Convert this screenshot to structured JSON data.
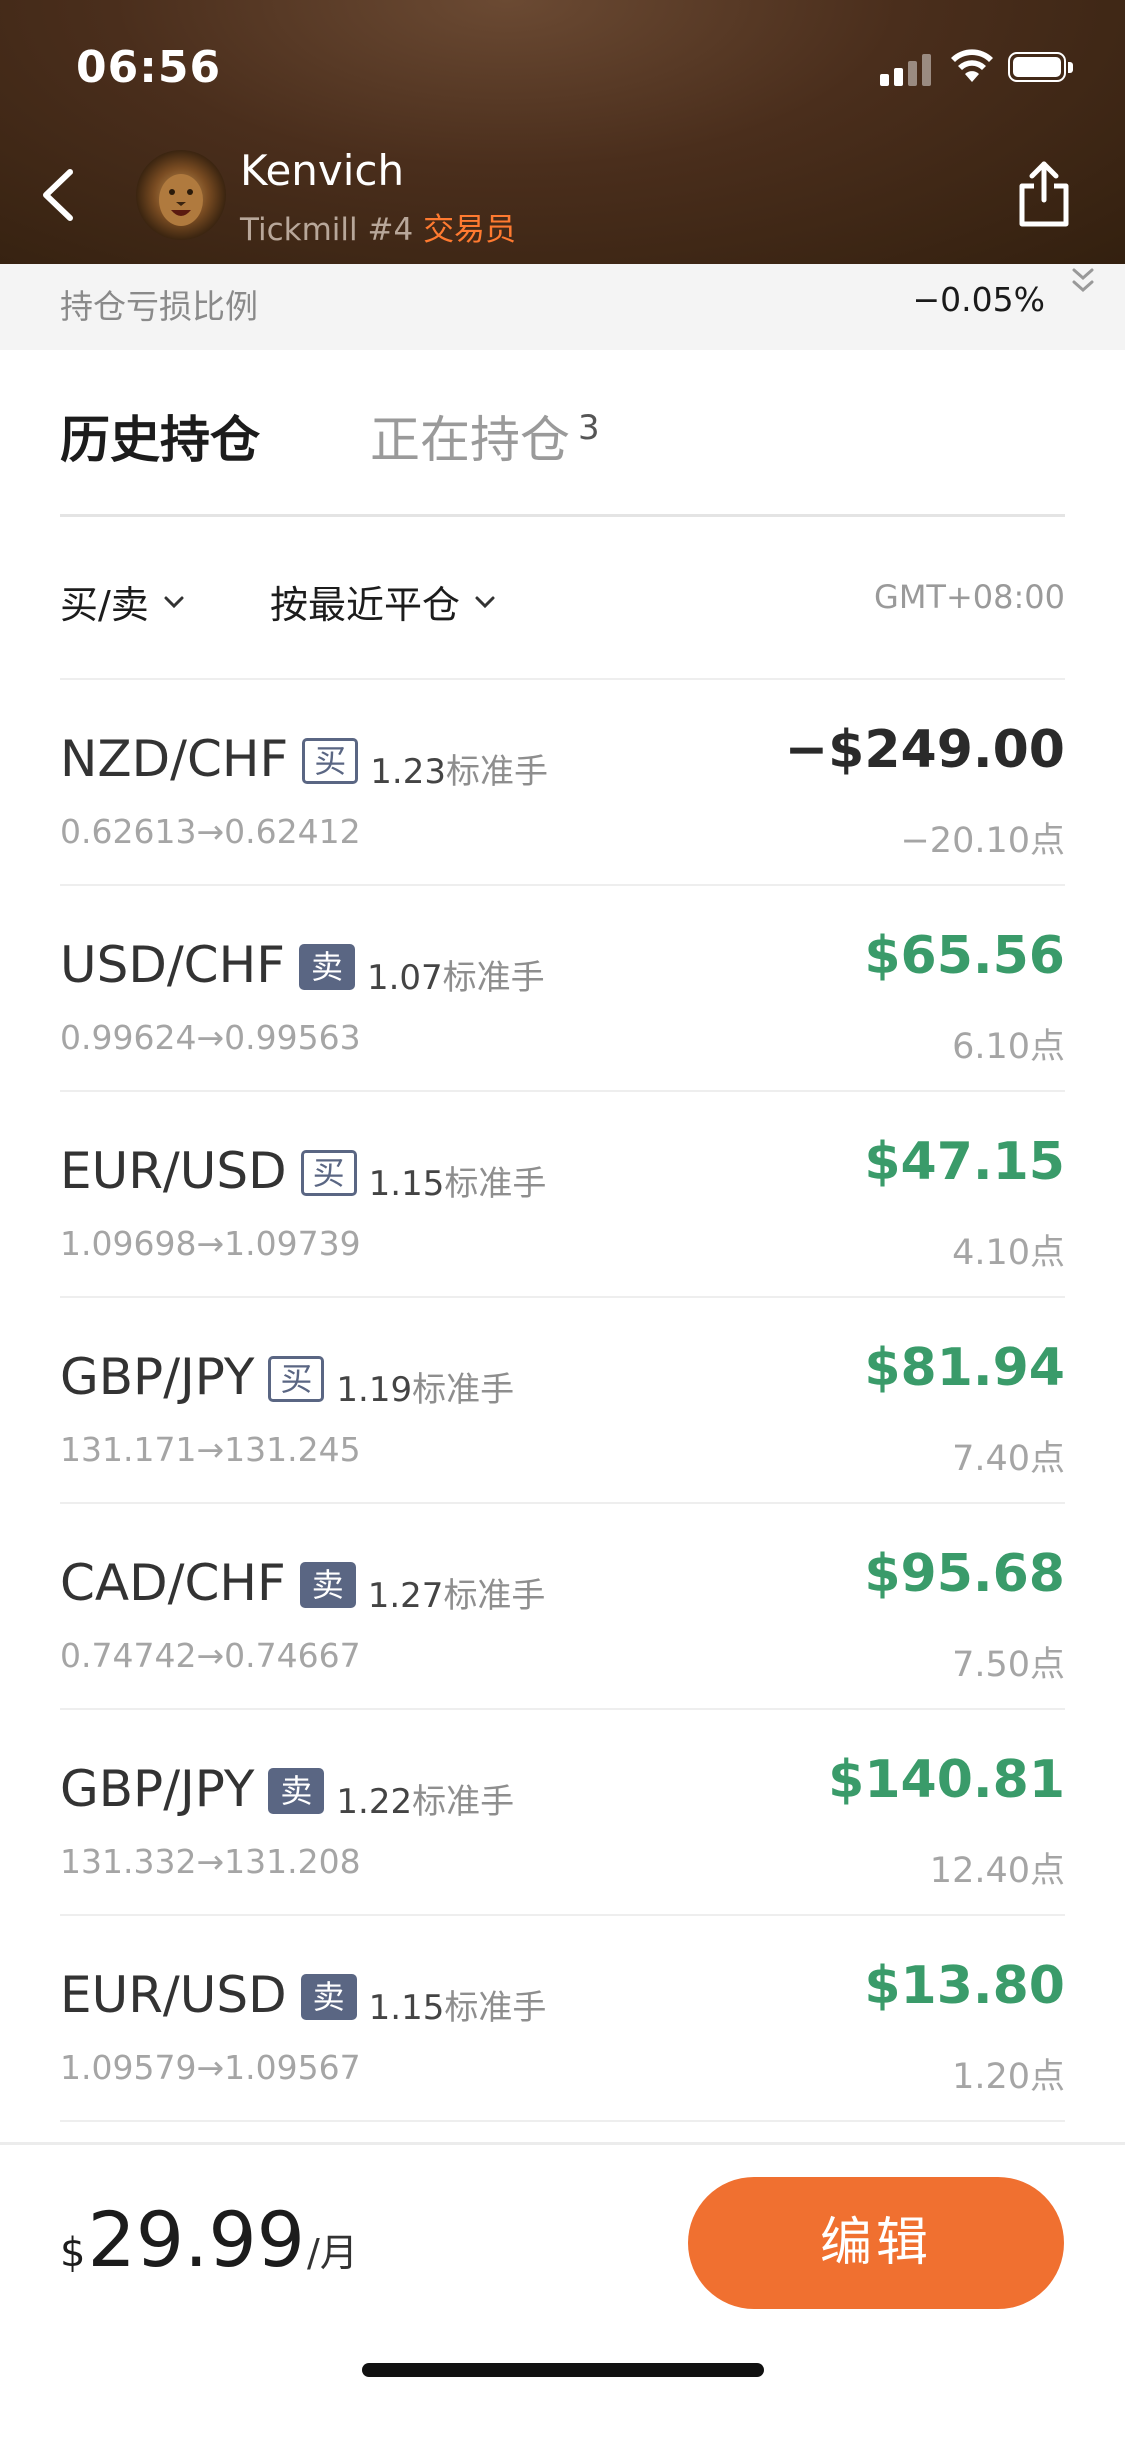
{
  "status_bar": {
    "time": "06:56"
  },
  "header": {
    "user_name": "Kenvich",
    "broker": "Tickmill",
    "rank": "#4",
    "role": "交易员"
  },
  "summary": {
    "label": "持仓亏损比例",
    "value": "−0.05%"
  },
  "tabs": [
    {
      "label": "历史持仓",
      "active": true
    },
    {
      "label": "正在持仓",
      "count": "3",
      "active": false
    }
  ],
  "filters": {
    "side_label": "买/卖",
    "sort_label": "按最近平仓",
    "timezone": "GMT+08:00"
  },
  "positions": [
    {
      "pair": "NZD/CHF",
      "side": "买",
      "lots": "1.23",
      "unit": "标准手",
      "open": "0.62613",
      "close": "0.62412",
      "pnl": "−$249.00",
      "points": "−20.10点",
      "positive": false
    },
    {
      "pair": "USD/CHF",
      "side": "卖",
      "lots": "1.07",
      "unit": "标准手",
      "open": "0.99624",
      "close": "0.99563",
      "pnl": "$65.56",
      "points": "6.10点",
      "positive": true
    },
    {
      "pair": "EUR/USD",
      "side": "买",
      "lots": "1.15",
      "unit": "标准手",
      "open": "1.09698",
      "close": "1.09739",
      "pnl": "$47.15",
      "points": "4.10点",
      "positive": true
    },
    {
      "pair": "GBP/JPY",
      "side": "买",
      "lots": "1.19",
      "unit": "标准手",
      "open": "131.171",
      "close": "131.245",
      "pnl": "$81.94",
      "points": "7.40点",
      "positive": true
    },
    {
      "pair": "CAD/CHF",
      "side": "卖",
      "lots": "1.27",
      "unit": "标准手",
      "open": "0.74742",
      "close": "0.74667",
      "pnl": "$95.68",
      "points": "7.50点",
      "positive": true
    },
    {
      "pair": "GBP/JPY",
      "side": "卖",
      "lots": "1.22",
      "unit": "标准手",
      "open": "131.332",
      "close": "131.208",
      "pnl": "$140.81",
      "points": "12.40点",
      "positive": true
    },
    {
      "pair": "EUR/USD",
      "side": "卖",
      "lots": "1.15",
      "unit": "标准手",
      "open": "1.09579",
      "close": "1.09567",
      "pnl": "$13.80",
      "points": "1.20点",
      "positive": true
    }
  ],
  "subscription": {
    "currency": "$",
    "amount": "29.99",
    "period": "/月",
    "edit_label": "编辑"
  },
  "colors": {
    "accent": "#f07030",
    "profit": "#3a9b6a",
    "badge": "#5a6683"
  }
}
